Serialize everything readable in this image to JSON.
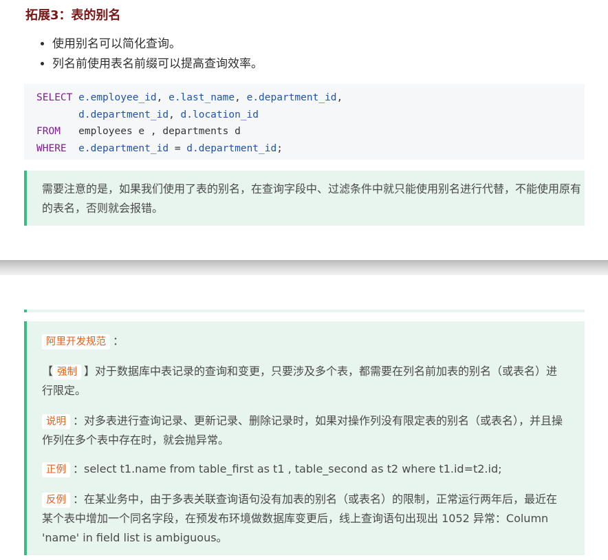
{
  "heading": "拓展3：表的别名",
  "bullets": [
    "使用别名可以简化查询。",
    "列名前使用表名前缀可以提高查询效率。"
  ],
  "code": {
    "select_kw": "SELECT",
    "from_kw": "FROM",
    "where_kw": "WHERE",
    "line1_fields": [
      "e.employee_id",
      "e.last_name",
      "e.department_id"
    ],
    "line2_fields": [
      "d.department_id",
      "d.location_id"
    ],
    "from_text": "employees e , departments d",
    "where_left": "e.department_id",
    "where_op": "=",
    "where_right": "d.department_id"
  },
  "note": "需要注意的是，如果我们使用了表的别名，在查询字段中、过滤条件中就只能使用别名进行代替，不能使用原有的表名，否则就会报错。",
  "spec": {
    "title_tag": "阿里开发规范",
    "title_colon": "：",
    "force_open": "【",
    "force_tag": "强制",
    "force_close": "】",
    "force_text": "对于数据库中表记录的查询和变更，只要涉及多个表，都需要在列名前加表的别名（或表名）进行限定。",
    "explain_tag": "说明",
    "explain_text": "：对多表进行查询记录、更新记录、删除记录时，如果对操作列没有限定表的别名（或表名），并且操作列在多个表中存在时，就会抛异常。",
    "positive_tag": "正例",
    "positive_text": "：select t1.name from table_first as t1 , table_second as t2 where t1.id=t2.id;",
    "negative_tag": "反例",
    "negative_text": "：在某业务中，由于多表关联查询语句没有加表的别名（或表名）的限制，正常运行两年后，最近在 某个表中增加一个同名字段，在预发布环境做数据库变更后，线上查询语句出现出 1052 异常：Column 'name' in field list is ambiguous。"
  }
}
